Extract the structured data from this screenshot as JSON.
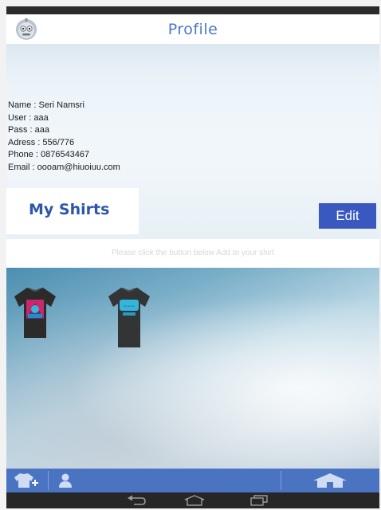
{
  "screen": {
    "title": "Profile",
    "app_icon": "robot-app-icon"
  },
  "profile": {
    "lines": [
      "Name : Seri  Namsri",
      "User : aaa",
      "Pass : aaa",
      "Adress : 556/776",
      "Phone : 0876543467",
      "Email : oooam@hiuoiuu.com"
    ]
  },
  "shirts": {
    "heading": "My Shirts",
    "edit_label": "Edit",
    "hint": "Please click the button below Add to your shirt",
    "items": [
      "shirt-icon-black-pink-print",
      "shirt-icon-black-cyan-print"
    ]
  },
  "navbar": {
    "icons": [
      "add-shirt-icon",
      "person-icon",
      "home-icon"
    ]
  },
  "system_nav": {
    "icons": [
      "back-icon",
      "home-outline-icon",
      "recent-apps-icon"
    ]
  },
  "colors": {
    "title": "#4a78c8",
    "heading": "#2e56a8",
    "edit_button": "#3a59c0",
    "navbar": "#4a74c2"
  }
}
